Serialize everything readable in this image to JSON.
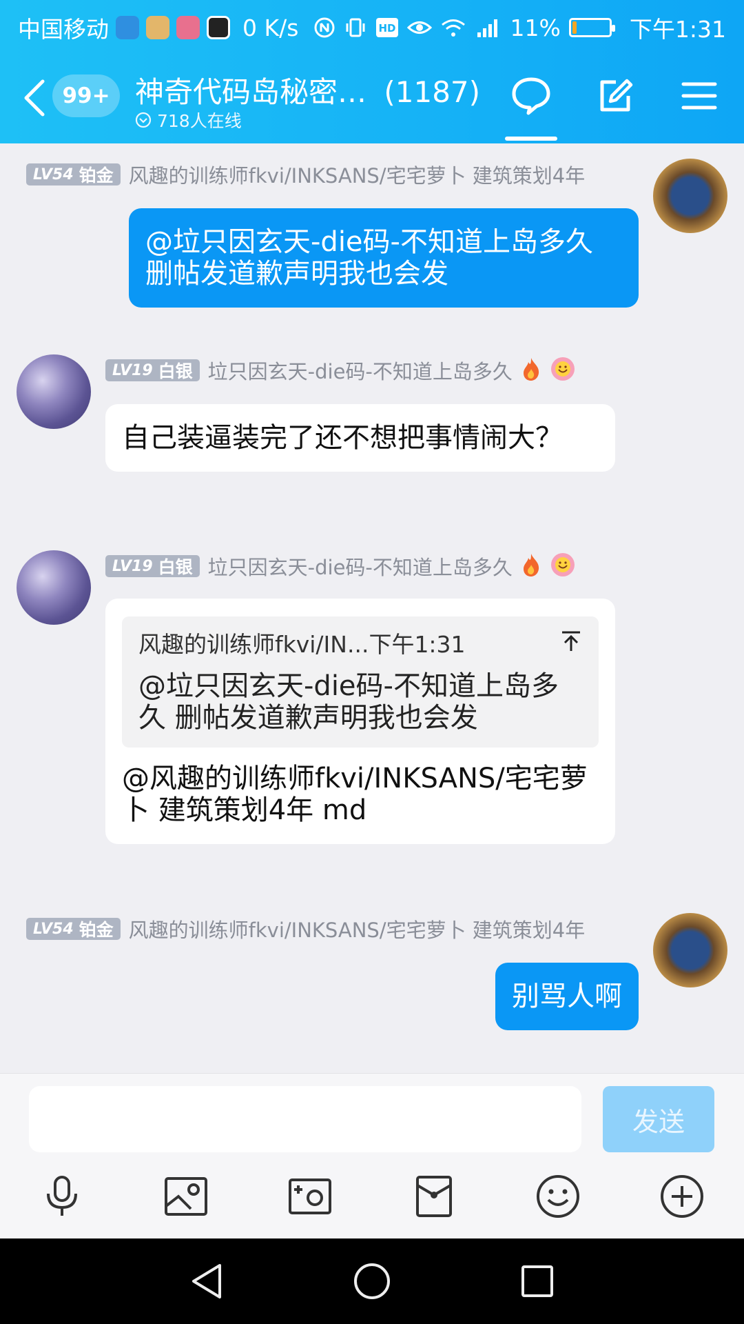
{
  "status_bar": {
    "carrier": "中国移动",
    "net_speed": "0 K/s",
    "battery": "11%",
    "battery_level": 0.11,
    "time": "下午1:31"
  },
  "header": {
    "back_label": "返回",
    "unread_count": "99+",
    "group_title": "神奇代码岛秘密…",
    "member_count": "(1187)",
    "online_text": "718人在线",
    "icons": [
      "chat-bubble-icon",
      "edit-icon",
      "menu-icon"
    ]
  },
  "messages": [
    {
      "side": "out",
      "level": "LV54",
      "rank": "铂金",
      "nickname": "风趣的训练师fkvi/INKSANS/宅宅萝卜 建筑策划4年",
      "text": "@垃只因玄天-die码-不知道上岛多久 删帖发道歉声明我也会发"
    },
    {
      "side": "in",
      "level": "LV19",
      "rank": "白银",
      "nickname": "垃只因玄天-die码-不知道上岛多久",
      "text": "自己装逼装完了还不想把事情闹大？"
    },
    {
      "side": "in",
      "level": "LV19",
      "rank": "白银",
      "nickname": "垃只因玄天-die码-不知道上岛多久",
      "quote_author": "风趣的训练师fkvi/IN...",
      "quote_time": "下午1:31",
      "quote_text": "@垃只因玄天-die码-不知道上岛多久 删帖发道歉声明我也会发",
      "text": "@风趣的训练师fkvi/INKSANS/宅宅萝卜 建筑策划4年 md"
    },
    {
      "side": "out",
      "level": "LV54",
      "rank": "铂金",
      "nickname": "风趣的训练师fkvi/INKSANS/宅宅萝卜 建筑策划4年",
      "text": "别骂人啊"
    }
  ],
  "input": {
    "value": "",
    "send_label": "发送"
  },
  "toolbar": [
    "mic-icon",
    "image-icon",
    "camera-icon",
    "red-packet-icon",
    "emoji-icon",
    "plus-icon"
  ],
  "colors": {
    "header": "#1ec0f6",
    "outgoing_bubble": "#0a97f5",
    "send_button": "#8fd1fa"
  }
}
